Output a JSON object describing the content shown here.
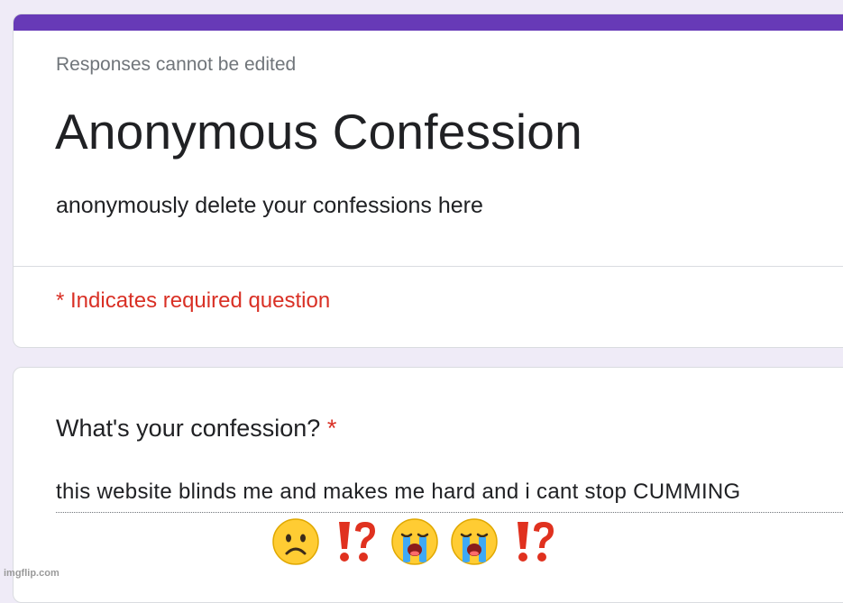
{
  "header": {
    "notice": "Responses cannot be edited",
    "title": "Anonymous Confession",
    "description": "anonymously delete your confessions here",
    "required_note": "* Indicates required question"
  },
  "question": {
    "label": "What's your confession?",
    "required_marker": "*",
    "answer": "this website blinds me and makes me hard and i cant stop CUMMING"
  },
  "emojis": [
    "frowning-face-icon",
    "interrobang-icon",
    "loudly-crying-face-icon",
    "loudly-crying-face-icon",
    "interrobang-icon"
  ],
  "watermark": "imgflip.com",
  "colors": {
    "accent": "#673ab7",
    "required": "#d93025",
    "background": "#efebf7"
  }
}
